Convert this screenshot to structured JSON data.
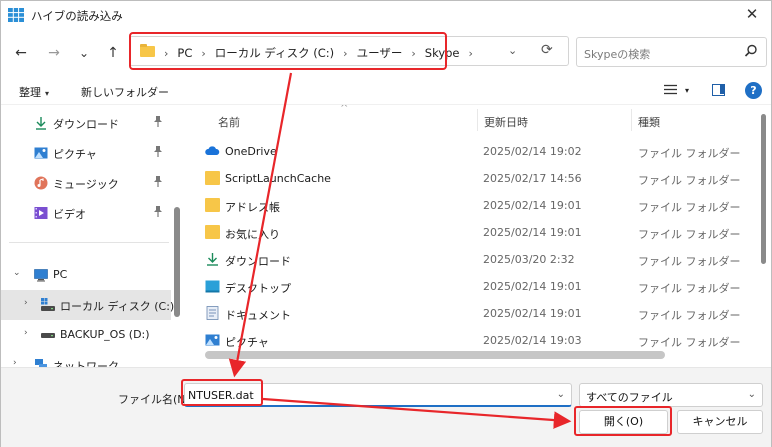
{
  "window": {
    "title": "ハイブの読み込み",
    "close_glyph": "✕"
  },
  "nav": {
    "back_glyph": "←",
    "forward_glyph": "→",
    "recent_glyph": "⌄",
    "up_glyph": "↑",
    "breadcrumbs": [
      "PC",
      "ローカル ディスク (C:)",
      "ユーザー",
      "Skype"
    ],
    "crumb_separator": "›",
    "address_dropdown_glyph": "⌄",
    "refresh_glyph": "⟳",
    "search_placeholder": "Skypeの検索"
  },
  "toolbar": {
    "organize_label": "整理",
    "organize_caret": "▾",
    "new_folder_label": "新しいフォルダー",
    "view_caret": "▾",
    "help_label": "?"
  },
  "navpane": {
    "items": [
      {
        "label": "ダウンロード",
        "icon": "download-icon",
        "pinned": true
      },
      {
        "label": "ピクチャ",
        "icon": "pictures-icon",
        "pinned": true
      },
      {
        "label": "ミュージック",
        "icon": "music-icon",
        "pinned": true
      },
      {
        "label": "ビデオ",
        "icon": "videos-icon",
        "pinned": true
      },
      {
        "label": "PC",
        "icon": "pc-icon",
        "expanded": true
      },
      {
        "label": "ローカル ディスク (C:)",
        "icon": "drive-icon",
        "selected": true
      },
      {
        "label": "BACKUP_OS (D:)",
        "icon": "drive-icon"
      },
      {
        "label": "ネットワーク",
        "icon": "network-icon"
      }
    ],
    "pin_glyph": "📌",
    "expanded_glyph": "⌄",
    "collapsed_glyph": "›"
  },
  "filelist": {
    "columns": {
      "name": "名前",
      "modified": "更新日時",
      "type": "種類"
    },
    "sort_caret": "^",
    "rows": [
      {
        "name": "OneDrive",
        "modified": "2025/02/14 19:02",
        "type": "ファイル フォルダー",
        "icon": "onedrive-icon"
      },
      {
        "name": "ScriptLaunchCache",
        "modified": "2025/02/17 14:56",
        "type": "ファイル フォルダー",
        "icon": "folder-icon"
      },
      {
        "name": "アドレス帳",
        "modified": "2025/02/14 19:01",
        "type": "ファイル フォルダー",
        "icon": "folder-icon"
      },
      {
        "name": "お気に入り",
        "modified": "2025/02/14 19:01",
        "type": "ファイル フォルダー",
        "icon": "folder-icon"
      },
      {
        "name": "ダウンロード",
        "modified": "2025/03/20 2:32",
        "type": "ファイル フォルダー",
        "icon": "download-icon"
      },
      {
        "name": "デスクトップ",
        "modified": "2025/02/14 19:01",
        "type": "ファイル フォルダー",
        "icon": "desktop-icon"
      },
      {
        "name": "ドキュメント",
        "modified": "2025/02/14 19:01",
        "type": "ファイル フォルダー",
        "icon": "documents-icon"
      },
      {
        "name": "ピクチャ",
        "modified": "2025/02/14 19:03",
        "type": "ファイル フォルダー",
        "icon": "pictures-icon"
      }
    ]
  },
  "bottom": {
    "filename_label": "ファイル名(N):",
    "filename_value": "NTUSER.dat",
    "filename_dropdown_glyph": "⌄",
    "filetype_value": "すべてのファイル",
    "filetype_dropdown_glyph": "⌄",
    "open_label": "開く(O)",
    "cancel_label": "キャンセル"
  },
  "colors": {
    "annotation_red": "#e8262a",
    "accent_blue": "#1f6fc5",
    "folder_yellow": "#f7c648"
  }
}
